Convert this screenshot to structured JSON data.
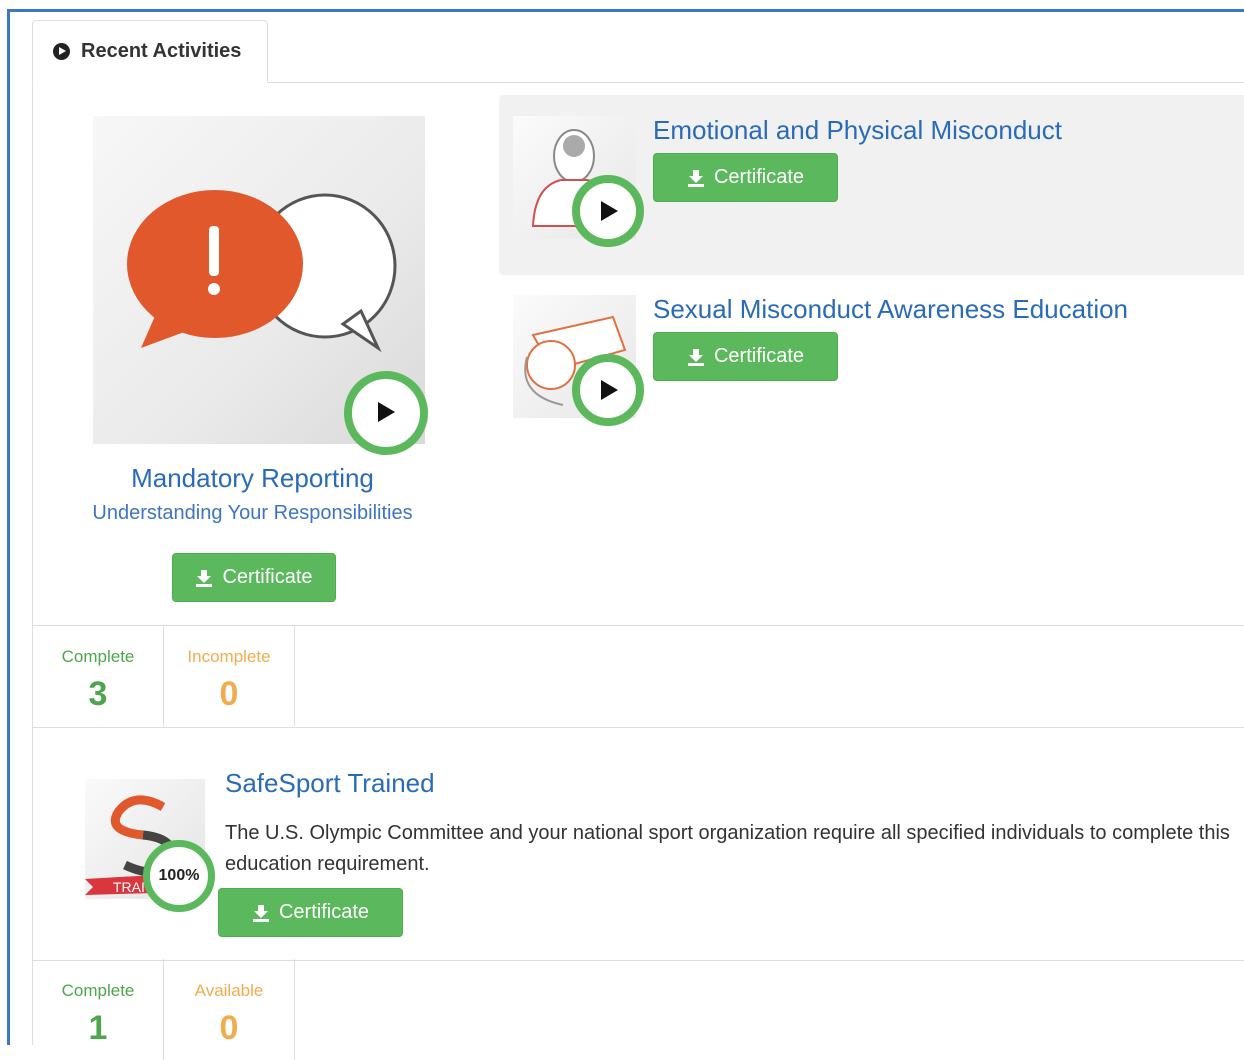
{
  "tab": {
    "label": "Recent Activities",
    "icon": "play-circle-icon"
  },
  "colors": {
    "accent_green": "#5cb85c",
    "link_blue": "#2a6bb8",
    "orange": "#f0ad4e",
    "frame_blue": "#3b78c0"
  },
  "featured": {
    "title": "Mandatory Reporting",
    "subtitle": "Understanding Your Responsibilities",
    "button": "Certificate",
    "icon": "speech-bubbles-exclamation-icon"
  },
  "courses": [
    {
      "title": "Emotional and Physical Misconduct",
      "button": "Certificate",
      "icon": "head-brain-icon"
    },
    {
      "title": "Sexual Misconduct Awareness Education",
      "button": "Certificate",
      "icon": "whistle-icon"
    }
  ],
  "stats1": {
    "complete_label": "Complete",
    "complete_value": "3",
    "incomplete_label": "Incomplete",
    "incomplete_value": "0"
  },
  "training": {
    "title": "SafeSport Trained",
    "description": "The U.S. Olympic Committee and your national sport organization require all specified individuals to complete this education requirement.",
    "button": "Certificate",
    "progress": "100%",
    "progress_fraction": 1.0,
    "ribbon_text": "TRAI"
  },
  "stats2": {
    "complete_label": "Complete",
    "complete_value": "1",
    "available_label": "Available",
    "available_value": "0"
  }
}
